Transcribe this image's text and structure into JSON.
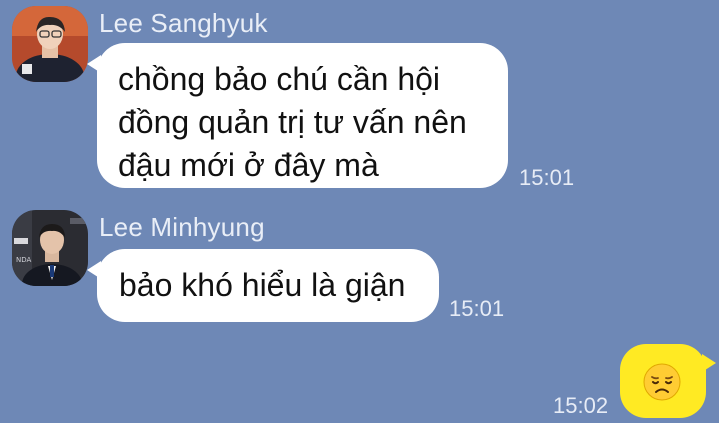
{
  "colors": {
    "background": "#6e88b6",
    "incoming_bubble": "#ffffff",
    "outgoing_bubble": "#ffea23",
    "sender_name": "#e9eef7",
    "timestamp": "#e7ecf6"
  },
  "messages": [
    {
      "sender": "Lee Sanghyuk",
      "avatar_icon": "person-photo-avatar",
      "lines": [
        "chồng bảo chú cần hội",
        "đồng quản trị tư vấn nên",
        "đậu mới ở đây mà"
      ],
      "time": "15:01"
    },
    {
      "sender": "Lee Minhyung",
      "avatar_icon": "person-photo-avatar",
      "lines": [
        "bảo khó hiểu là giận"
      ],
      "time": "15:01"
    },
    {
      "sender": "",
      "outgoing": true,
      "emoji_icon": "disappointed-face-emoji",
      "time": "15:02"
    }
  ]
}
